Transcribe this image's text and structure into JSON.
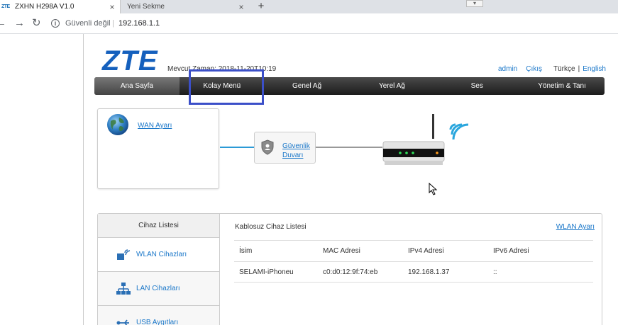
{
  "browser": {
    "tabs": [
      {
        "favicon": "ZTE",
        "title": "ZXHN H298A V1.0",
        "close": "×"
      },
      {
        "title": "Yeni Sekme",
        "close": "×"
      }
    ],
    "new_tab": "+",
    "security_label": "Güvenli değil",
    "separator": "|",
    "url": "192.168.1.1"
  },
  "header": {
    "logo": "ZTE",
    "current_time": "Mevcut Zaman: 2018-11-20T10:19",
    "user": "admin",
    "logout": "Çıkış",
    "lang_current": "Türkçe",
    "lang_sep": "|",
    "lang_other": "English"
  },
  "nav": {
    "items": [
      "Ana Sayfa",
      "Kolay Menü",
      "Genel Ağ",
      "Yerel Ağ",
      "Ses",
      "Yönetim & Tanı"
    ]
  },
  "topology": {
    "wan_link": "WAN Ayarı",
    "firewall_line1": "Güvenlik",
    "firewall_line2": "Duvarı"
  },
  "devices": {
    "side_header": "Cihaz Listesi",
    "side_items": [
      "WLAN Cihazları",
      "LAN Cihazları",
      "USB Aygıtları"
    ],
    "title": "Kablosuz Cihaz Listesi",
    "link": "WLAN Ayarı",
    "columns": [
      "İsim",
      "MAC Adresi",
      "IPv4 Adresi",
      "IPv6 Adresi"
    ],
    "rows": [
      [
        "SELAMI-iPhoneu",
        "c0:d0:12:9f:74:eb",
        "192.168.1.37",
        "::"
      ]
    ]
  },
  "colors": {
    "brand": "#1560bd",
    "link": "#1a77c9",
    "highlight": "#3b4fc8"
  }
}
